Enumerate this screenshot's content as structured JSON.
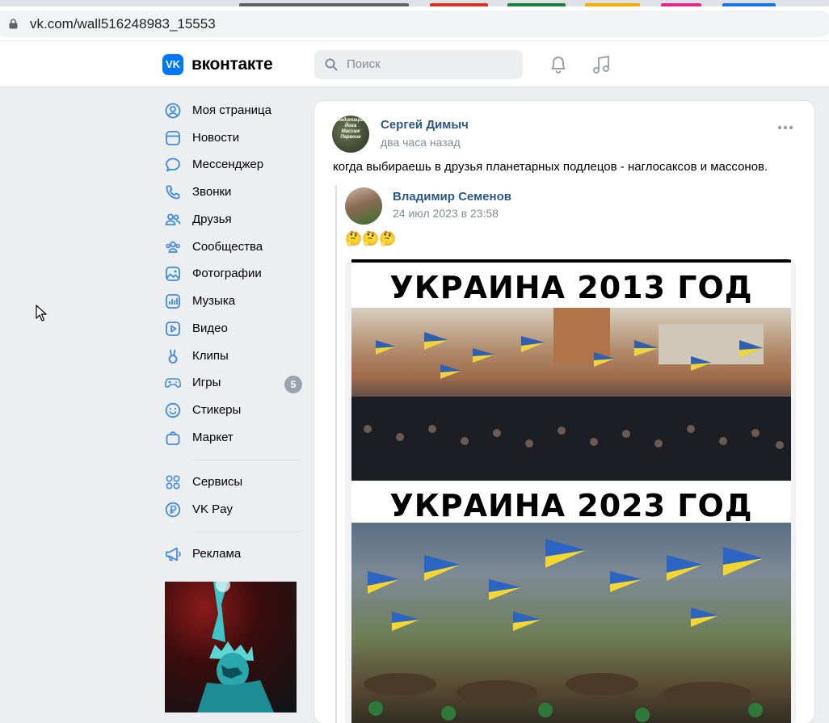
{
  "browser": {
    "url": "vk.com/wall516248983_15553"
  },
  "header": {
    "logo": "VK",
    "brand": "вконтакте",
    "search_placeholder": "Поиск"
  },
  "sidebar": {
    "items": [
      {
        "label": "Моя страница",
        "icon": "user-circle-icon"
      },
      {
        "label": "Новости",
        "icon": "newsfeed-icon"
      },
      {
        "label": "Мессенджер",
        "icon": "message-icon"
      },
      {
        "label": "Звонки",
        "icon": "phone-icon"
      },
      {
        "label": "Друзья",
        "icon": "friends-icon"
      },
      {
        "label": "Сообщества",
        "icon": "communities-icon"
      },
      {
        "label": "Фотографии",
        "icon": "photo-icon"
      },
      {
        "label": "Музыка",
        "icon": "music-icon"
      },
      {
        "label": "Видео",
        "icon": "video-icon"
      },
      {
        "label": "Клипы",
        "icon": "clips-icon"
      },
      {
        "label": "Игры",
        "icon": "games-icon",
        "badge": "5"
      },
      {
        "label": "Стикеры",
        "icon": "stickers-icon"
      },
      {
        "label": "Маркет",
        "icon": "market-icon"
      },
      {
        "label": "Сервисы",
        "icon": "services-icon"
      },
      {
        "label": "VK Pay",
        "icon": "vkpay-icon"
      },
      {
        "label": "Реклама",
        "icon": "ads-icon"
      }
    ]
  },
  "post": {
    "author": "Сергей Димыч",
    "time": "два часа назад",
    "text": "когда выбираешь в друзья планетарных подлецов - наглосаксов и массонов.",
    "avatar_text": "Медитация Йога Массаж Парение",
    "repost": {
      "author": "Владимир Семенов",
      "time": "24 июл 2023 в 23:58",
      "emoji": "🤔🤔🤔",
      "image_caption_top": "УКРАИНА 2013 ГОД",
      "image_caption_bottom": "УКРАИНА 2023 ГОД"
    }
  },
  "colors": {
    "accent": "#0077ff",
    "link": "#2a5885",
    "secondary_text": "#818c99",
    "page_bg": "#edeef0"
  }
}
